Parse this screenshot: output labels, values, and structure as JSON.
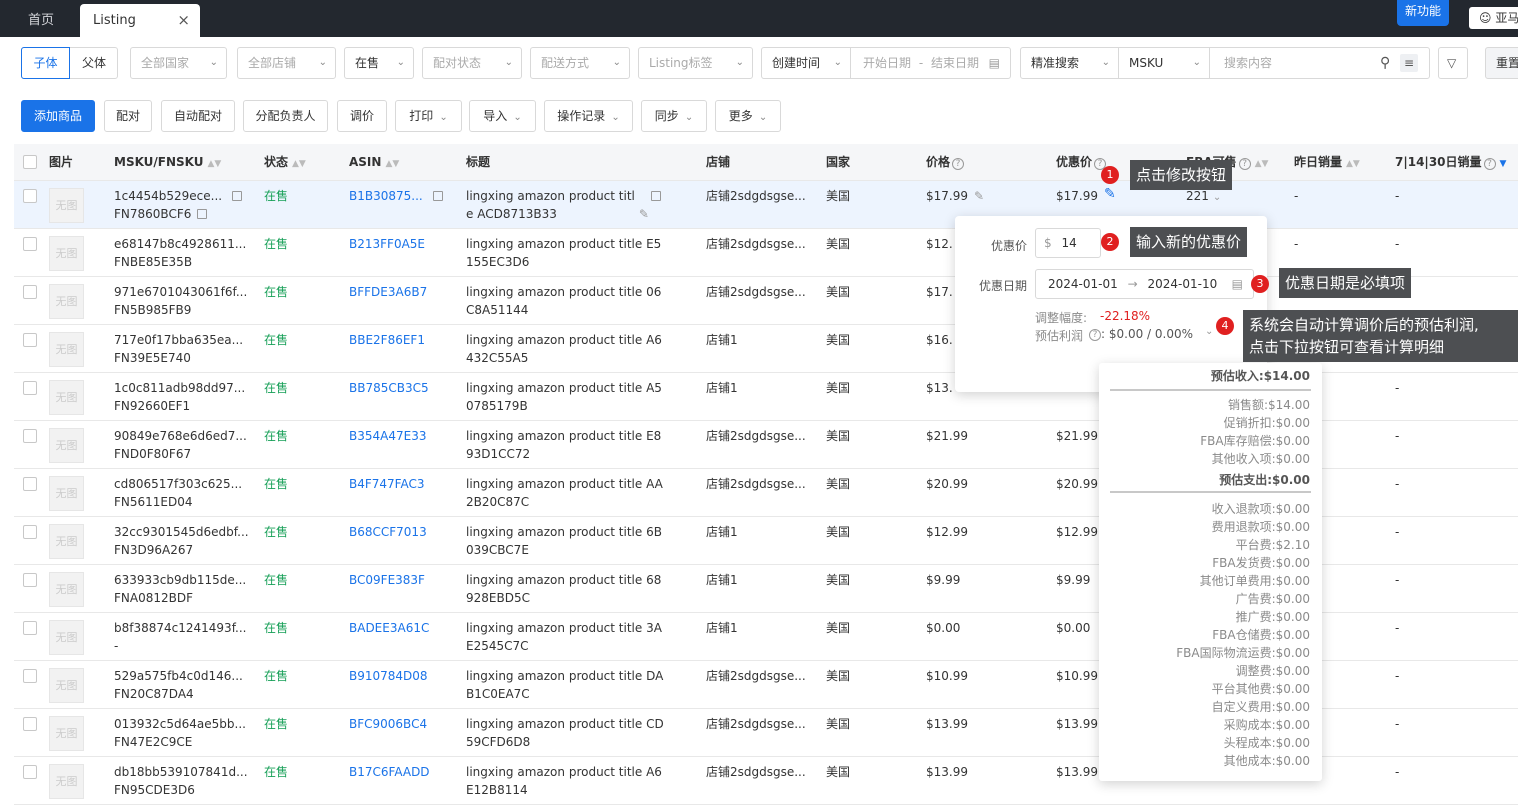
{
  "tabs": {
    "home": "首页",
    "listing": "Listing",
    "close": "×"
  },
  "header": {
    "new_feature": "新功能",
    "user": "亚马"
  },
  "filters": {
    "child": "子体",
    "parent": "父体",
    "country": "全部国家",
    "store": "全部店铺",
    "status": "在售",
    "pair_status": "配对状态",
    "ship_method": "配送方式",
    "listing_tag": "Listing标签",
    "time_type": "创建时间",
    "start_date": "开始日期",
    "dash": "-",
    "end_date": "结束日期",
    "search_mode": "精准搜索",
    "search_field": "MSKU",
    "search_placeholder": "搜索内容",
    "reset": "重置"
  },
  "toolbar": {
    "add": "添加商品",
    "pair": "配对",
    "auto_pair": "自动配对",
    "assign": "分配负责人",
    "reprice": "调价",
    "print": "打印",
    "import": "导入",
    "op_log": "操作记录",
    "sync": "同步",
    "more": "更多"
  },
  "columns": {
    "image": "图片",
    "msku": "MSKU/FNSKU",
    "status": "状态",
    "asin": "ASIN",
    "title": "标题",
    "store": "店铺",
    "country": "国家",
    "price": "价格",
    "sale_price": "优惠价",
    "fba": "FBA可售",
    "yesterday": "昨日销量",
    "sales": "7|14|30日销量"
  },
  "thumb_text": "无图",
  "rows": [
    {
      "msku": "1c4454b529ece...",
      "fnsku": "FN7860BCF6",
      "status": "在售",
      "asin": "B1B30875...",
      "title1": "lingxing amazon product titl",
      "title2": "e ACD8713B33",
      "store": "店铺2sdgdsgse...",
      "country": "美国",
      "price": "$17.99",
      "sale": "$17.99",
      "fba": "221",
      "yest": "-",
      "sales": "-"
    },
    {
      "msku": "e68147b8c4928611...",
      "fnsku": "FNBE85E35B",
      "status": "在售",
      "asin": "B213FF0A5E",
      "title1": "lingxing amazon product title E5",
      "title2": "155EC3D6",
      "store": "店铺2sdgdsgse...",
      "country": "美国",
      "price": "$12.",
      "sale": "",
      "fba": "",
      "yest": "-",
      "sales": "-"
    },
    {
      "msku": "971e6701043061f6f...",
      "fnsku": "FN5B985FB9",
      "status": "在售",
      "asin": "BFFDE3A6B7",
      "title1": "lingxing amazon product title 06",
      "title2": "C8A51144",
      "store": "店铺2sdgdsgse...",
      "country": "美国",
      "price": "$17.",
      "sale": "",
      "fba": "",
      "yest": "",
      "sales": "-"
    },
    {
      "msku": "717e0f17bba635ea...",
      "fnsku": "FN39E5E740",
      "status": "在售",
      "asin": "BBE2F86EF1",
      "title1": "lingxing amazon product title A6",
      "title2": "432C55A5",
      "store": "店铺1",
      "country": "美国",
      "price": "$16.",
      "sale": "",
      "fba": "",
      "yest": "",
      "sales": "-"
    },
    {
      "msku": "1c0c811adb98dd97...",
      "fnsku": "FN92660EF1",
      "status": "在售",
      "asin": "BB785CB3C5",
      "title1": "lingxing amazon product title A5",
      "title2": "0785179B",
      "store": "店铺1",
      "country": "美国",
      "price": "$13.",
      "sale": "",
      "fba": "",
      "yest": "",
      "sales": "-"
    },
    {
      "msku": "90849e768e6d6ed7...",
      "fnsku": "FND0F80F67",
      "status": "在售",
      "asin": "B354A47E33",
      "title1": "lingxing amazon product title E8",
      "title2": "93D1CC72",
      "store": "店铺2sdgdsgse...",
      "country": "美国",
      "price": "$21.99",
      "sale": "$21.99",
      "fba": "",
      "yest": "",
      "sales": "-"
    },
    {
      "msku": "cd806517f303c625...",
      "fnsku": "FN5611ED04",
      "status": "在售",
      "asin": "B4F747FAC3",
      "title1": "lingxing amazon product title AA",
      "title2": "2B20C87C",
      "store": "店铺2sdgdsgse...",
      "country": "美国",
      "price": "$20.99",
      "sale": "$20.99",
      "fba": "",
      "yest": "",
      "sales": "-"
    },
    {
      "msku": "32cc9301545d6edbf...",
      "fnsku": "FN3D96A267",
      "status": "在售",
      "asin": "B68CCF7013",
      "title1": "lingxing amazon product title 6B",
      "title2": "039CBC7E",
      "store": "店铺1",
      "country": "美国",
      "price": "$12.99",
      "sale": "$12.99",
      "fba": "",
      "yest": "",
      "sales": "-"
    },
    {
      "msku": "633933cb9db115de...",
      "fnsku": "FNA0812BDF",
      "status": "在售",
      "asin": "BC09FE383F",
      "title1": "lingxing amazon product title 68",
      "title2": "928EBD5C",
      "store": "店铺1",
      "country": "美国",
      "price": "$9.99",
      "sale": "$9.99",
      "fba": "",
      "yest": "",
      "sales": "-"
    },
    {
      "msku": "b8f38874c1241493f...",
      "fnsku": "-",
      "status": "在售",
      "asin": "BADEE3A61C",
      "title1": "lingxing amazon product title 3A",
      "title2": "E2545C7C",
      "store": "店铺1",
      "country": "美国",
      "price": "$0.00",
      "sale": "$0.00",
      "fba": "",
      "yest": "",
      "sales": "-"
    },
    {
      "msku": "529a575fb4c0d146...",
      "fnsku": "FN20C87DA4",
      "status": "在售",
      "asin": "B910784D08",
      "title1": "lingxing amazon product title DA",
      "title2": "B1C0EA7C",
      "store": "店铺2sdgdsgse...",
      "country": "美国",
      "price": "$10.99",
      "sale": "$10.99",
      "fba": "",
      "yest": "",
      "sales": "-"
    },
    {
      "msku": "013932c5d64ae5bb...",
      "fnsku": "FN47E2C9CE",
      "status": "在售",
      "asin": "BFC9006BC4",
      "title1": "lingxing amazon product title CD",
      "title2": "59CFD6D8",
      "store": "店铺2sdgdsgse...",
      "country": "美国",
      "price": "$13.99",
      "sale": "$13.99",
      "fba": "",
      "yest": "",
      "sales": "-"
    },
    {
      "msku": "db18bb539107841d...",
      "fnsku": "FN95CDE3D6",
      "status": "在售",
      "asin": "B17C6FAADD",
      "title1": "lingxing amazon product title A6",
      "title2": "E12B8114",
      "store": "店铺2sdgdsgse...",
      "country": "美国",
      "price": "$13.99",
      "sale": "$13.99",
      "fba": "",
      "yest": "",
      "sales": "-"
    }
  ],
  "popover": {
    "sale_label": "优惠价",
    "currency": "$",
    "sale_value": "14",
    "date_label": "优惠日期",
    "date_start": "2024-01-01",
    "arrow": "→",
    "date_end": "2024-01-10",
    "change_label": "调整幅度:",
    "change_value": "-22.18%",
    "profit_label": "预估利润",
    "profit_value": ": $0.00 / 0.00%"
  },
  "breakdown": {
    "income_head": "预估收入:$14.00",
    "income": [
      "销售额:$14.00",
      "促销折扣:$0.00",
      "FBA库存赔偿:$0.00",
      "其他收入项:$0.00"
    ],
    "expense_head": "预估支出:$0.00",
    "expense": [
      "收入退款项:$0.00",
      "费用退款项:$0.00",
      "平台费:$2.10",
      "FBA发货费:$0.00",
      "其他订单费用:$0.00",
      "广告费:$0.00",
      "推广费:$0.00",
      "FBA仓储费:$0.00",
      "FBA国际物流运费:$0.00",
      "调整费:$0.00",
      "平台其他费:$0.00",
      "自定义费用:$0.00",
      "采购成本:$0.00",
      "头程成本:$0.00",
      "其他成本:$0.00"
    ]
  },
  "callouts": {
    "n1": "1",
    "t1": "点击修改按钮",
    "n2": "2",
    "t2": "输入新的优惠价",
    "n3": "3",
    "t3": "优惠日期是必填项",
    "n4": "4",
    "t4a": "系统会自动计算调价后的预估利润,",
    "t4b": "点击下拉按钮可查看计算明细"
  },
  "colors": {
    "primary": "#1a73e8",
    "success": "#18a058",
    "danger": "#e02020",
    "topbar": "#23282f"
  }
}
